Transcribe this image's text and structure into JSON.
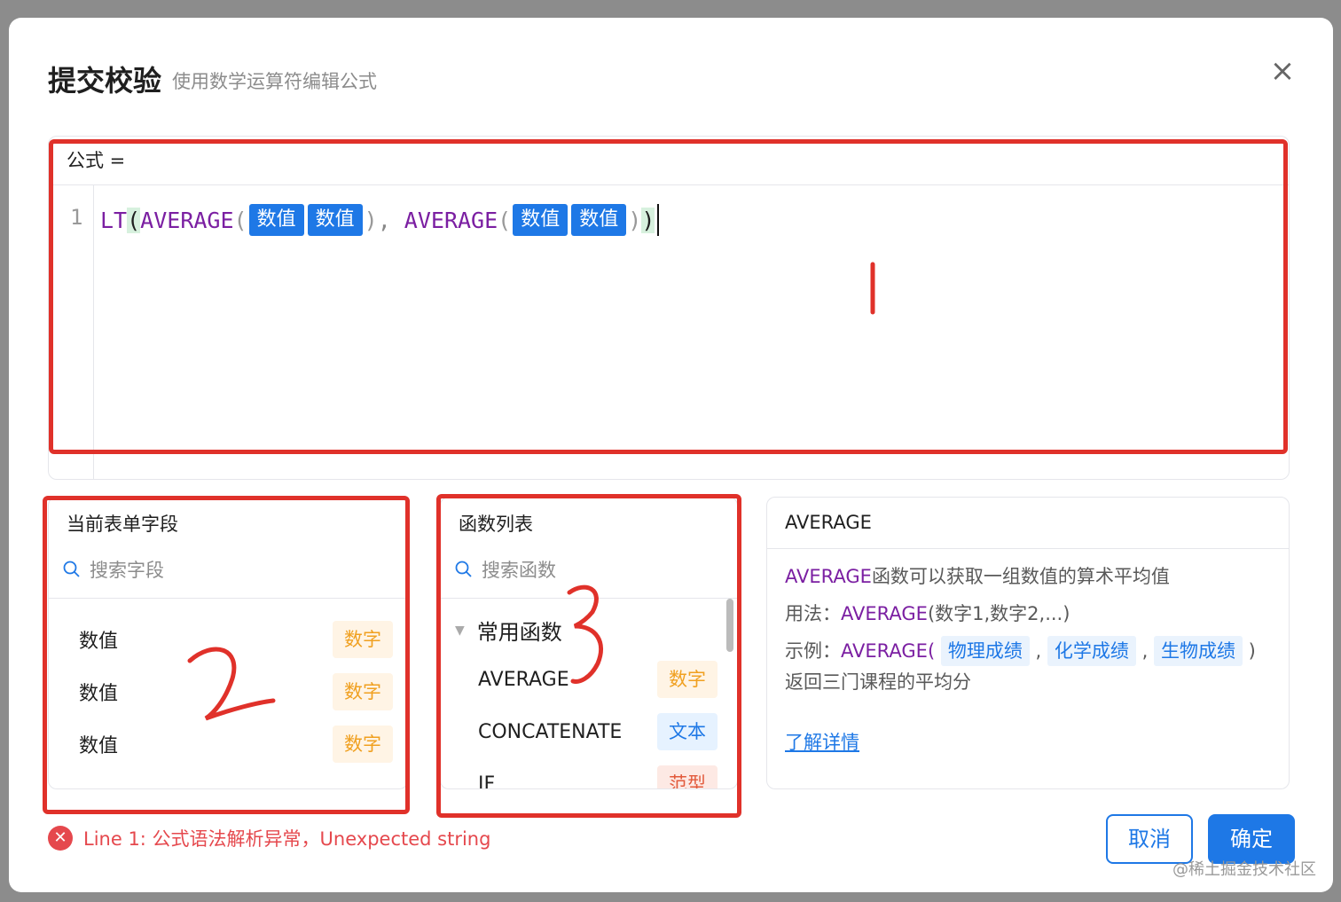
{
  "dialog": {
    "title": "提交校验",
    "subtitle": "使用数学运算符编辑公式",
    "close_icon": "close-icon"
  },
  "editor": {
    "label": "公式 =",
    "line_number": "1",
    "tokens": {
      "fn_lt": "LT",
      "lparen_outer": "(",
      "fn_avg1": "AVERAGE",
      "lparen_1": "(",
      "chip_1": "数值",
      "chip_2": "数值",
      "rparen_1": ")",
      "comma": ", ",
      "fn_avg2": "AVERAGE",
      "lparen_2": "(",
      "chip_3": "数值",
      "chip_4": "数值",
      "rparen_2": ")",
      "rparen_outer": ")"
    }
  },
  "fields_panel": {
    "title": "当前表单字段",
    "search_placeholder": "搜索字段",
    "items": [
      {
        "name": "数值",
        "type": "数字"
      },
      {
        "name": "数值",
        "type": "数字"
      },
      {
        "name": "数值",
        "type": "数字"
      }
    ]
  },
  "functions_panel": {
    "title": "函数列表",
    "search_placeholder": "搜索函数",
    "group": "常用函数",
    "items": [
      {
        "name": "AVERAGE",
        "type": "数字"
      },
      {
        "name": "CONCATENATE",
        "type": "文本"
      },
      {
        "name": "IF",
        "type": "范型"
      }
    ]
  },
  "doc_panel": {
    "title": "AVERAGE",
    "desc_fn": "AVERAGE",
    "desc_text": "函数可以获取一组数值的算术平均值",
    "usage_label": "用法：",
    "usage_fn": "AVERAGE",
    "usage_args": "(数字1,数字2,...)",
    "example_label": "示例：",
    "example_fn": "AVERAGE",
    "example_open": "(",
    "example_args": [
      "物理成绩",
      "化学成绩",
      "生物成绩"
    ],
    "example_sep": ",",
    "example_close": ")",
    "example_result": "返回三门课程的平均分",
    "learn_more": "了解详情"
  },
  "error": {
    "message": "Line 1: 公式语法解析异常，Unexpected string"
  },
  "buttons": {
    "cancel": "取消",
    "ok": "确定"
  },
  "annotations": {
    "mark_1": "1",
    "mark_2": "2",
    "mark_3": "3",
    "color": "#e0312a"
  },
  "watermark": "@稀土掘金技术社区",
  "colors": {
    "primary": "#1e78e6",
    "function": "#7b1fa2",
    "error": "#e5484d",
    "tag_number_bg": "#fff4e5",
    "tag_text_bg": "#e6f2ff"
  }
}
